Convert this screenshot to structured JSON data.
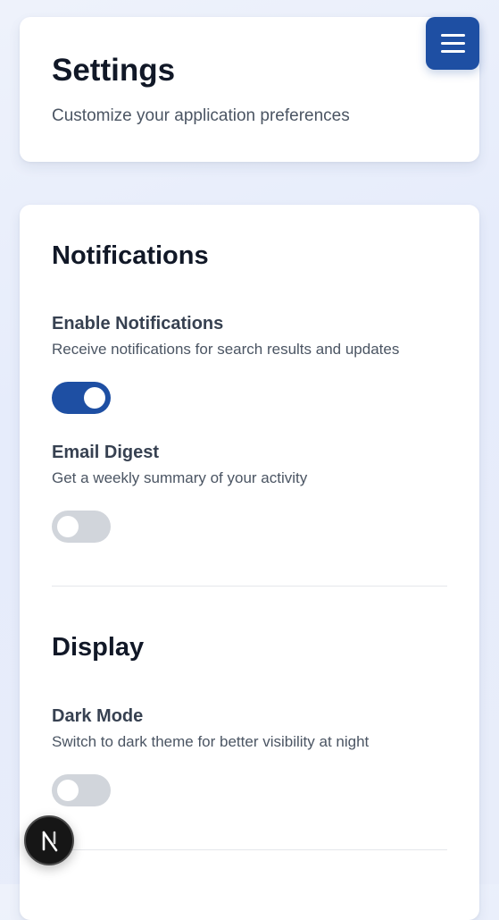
{
  "header": {
    "title": "Settings",
    "subtitle": "Customize your application preferences"
  },
  "menu_button": {
    "icon": "hamburger-menu-icon",
    "color": "#1e4fa3"
  },
  "sections": [
    {
      "title": "Notifications",
      "settings": [
        {
          "label": "Enable Notifications",
          "description": "Receive notifications for search results and updates",
          "enabled": true
        },
        {
          "label": "Email Digest",
          "description": "Get a weekly summary of your activity",
          "enabled": false
        }
      ]
    },
    {
      "title": "Display",
      "settings": [
        {
          "label": "Dark Mode",
          "description": "Switch to dark theme for better visibility at night",
          "enabled": false
        }
      ]
    }
  ],
  "dev_badge": {
    "letter": "N",
    "icon": "nextjs-logo-icon"
  },
  "colors": {
    "accent": "#1e4fa3",
    "toggle_off": "#d1d5db"
  }
}
